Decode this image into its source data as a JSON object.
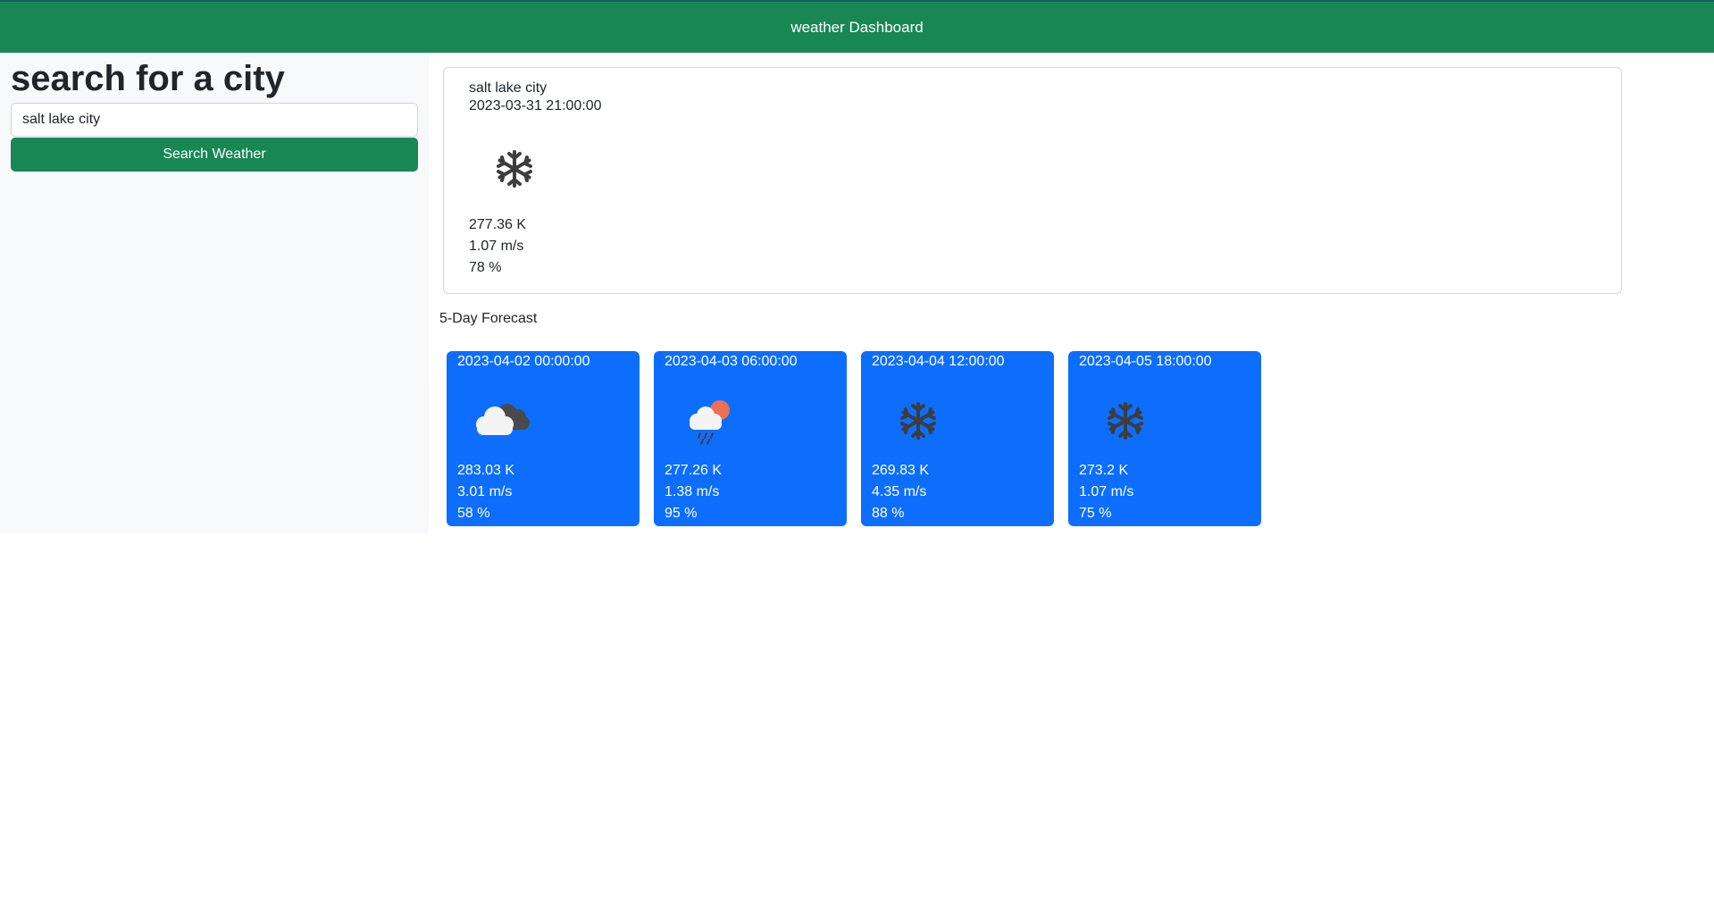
{
  "header": {
    "title": "weather Dashboard"
  },
  "sidebar": {
    "heading": "search for a city",
    "search": {
      "value": "salt lake city",
      "placeholder": ""
    },
    "button_label": "Search Weather"
  },
  "current": {
    "city": "salt lake city",
    "datetime": "2023-03-31 21:00:00",
    "icon": "snowflake-icon",
    "temp": "277.36 K",
    "wind": "1.07 m/s",
    "humidity": "78 %"
  },
  "forecast_title": "5-Day Forecast",
  "forecast": [
    {
      "datetime": "2023-04-02 00:00:00",
      "icon": "clouds-icon",
      "temp": "283.03 K",
      "wind": "3.01 m/s",
      "humidity": "58 %"
    },
    {
      "datetime": "2023-04-03 06:00:00",
      "icon": "rain-sun-icon",
      "temp": "277.26 K",
      "wind": "1.38 m/s",
      "humidity": "95 %"
    },
    {
      "datetime": "2023-04-04 12:00:00",
      "icon": "snowflake-icon",
      "temp": "269.83 K",
      "wind": "4.35 m/s",
      "humidity": "88 %"
    },
    {
      "datetime": "2023-04-05 18:00:00",
      "icon": "snowflake-icon",
      "temp": "273.2 K",
      "wind": "1.07 m/s",
      "humidity": "75 %"
    }
  ],
  "colors": {
    "header_bg": "#198754",
    "button_bg": "#198754",
    "forecast_card_bg": "#0d6efd",
    "sidebar_bg": "#f8f9fa"
  }
}
